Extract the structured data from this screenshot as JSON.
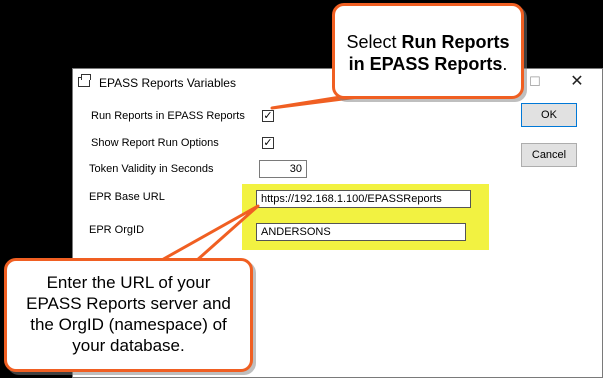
{
  "dialog": {
    "title": "EPASS Reports Variables",
    "maximize_glyph": "☐",
    "close_glyph": "✕"
  },
  "fields": {
    "run_reports_label": "Run Reports in EPASS Reports",
    "run_reports_checked": "✓",
    "show_options_label": "Show Report Run Options",
    "show_options_checked": "✓",
    "token_label": "Token Validity in Seconds",
    "token_value": "30",
    "base_url_label": "EPR Base URL",
    "base_url_value": "https://192.168.1.100/EPASSReports",
    "orgid_label": "EPR OrgID",
    "orgid_value": "ANDERSONS"
  },
  "buttons": {
    "ok": "OK",
    "cancel": "Cancel"
  },
  "callouts": {
    "top_prefix": "Select ",
    "top_bold_1": "Run Reports",
    "top_bold_2": "in EPASS Reports",
    "top_suffix": ".",
    "bottom_line1": "Enter the URL of your",
    "bottom_line2": "EPASS Reports server and",
    "bottom_line3": "the OrgID (namespace) of",
    "bottom_line4": "your database."
  },
  "colors": {
    "callout_border": "#f05f22",
    "highlight": "#f2f241",
    "background": "#000000"
  }
}
